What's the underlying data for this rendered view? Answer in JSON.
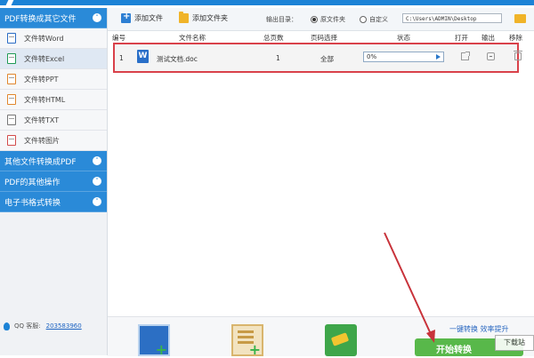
{
  "sidebar": {
    "categories": [
      {
        "label": "PDF转换成其它文件",
        "expanded": true
      },
      {
        "label": "其他文件转换成PDF",
        "expanded": false
      },
      {
        "label": "PDF的其他操作",
        "expanded": false
      },
      {
        "label": "电子书格式转换",
        "expanded": false
      }
    ],
    "items": [
      {
        "label": "文件转Word",
        "icon": "word-file-icon"
      },
      {
        "label": "文件转Excel",
        "icon": "excel-file-icon",
        "active": true
      },
      {
        "label": "文件转PPT",
        "icon": "ppt-file-icon"
      },
      {
        "label": "文件转HTML",
        "icon": "html-file-icon"
      },
      {
        "label": "文件转TXT",
        "icon": "txt-file-icon"
      },
      {
        "label": "文件转图片",
        "icon": "image-file-icon"
      }
    ],
    "qq": {
      "label": "QQ 客服:",
      "number": "203583960"
    }
  },
  "toolbar": {
    "add_file": "添加文件",
    "add_folder": "添加文件夹",
    "output_label": "输出目录：",
    "radio_original": "原文件夹",
    "radio_custom": "自定义",
    "output_path": "C:\\Users\\ADMIN\\Desktop"
  },
  "table": {
    "headers": [
      "编号",
      "文件名称",
      "总页数",
      "页码选择",
      "状态",
      "打开",
      "输出",
      "移除"
    ],
    "rows": [
      {
        "index": "1",
        "name": "测试文档.doc",
        "pages": "1",
        "page_select": "全部",
        "status": "0%",
        "progress": 0
      }
    ]
  },
  "bottom": {
    "slogan": "一键转换  效率提升",
    "convert_label": "开始转换",
    "watermark": "下载站"
  },
  "colors": {
    "accent": "#2a8ad8",
    "highlight": "#d9414a",
    "convert": "#58b84a"
  }
}
